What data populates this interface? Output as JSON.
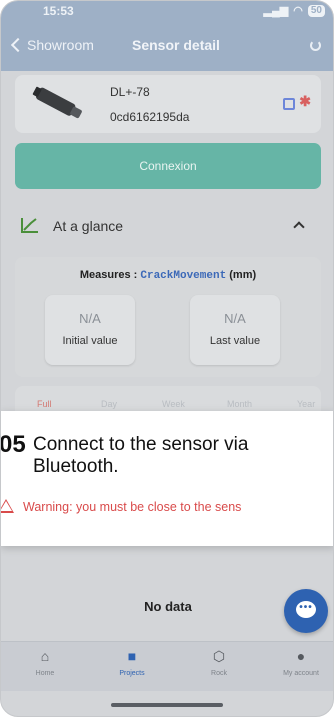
{
  "status": {
    "time": "15:53",
    "battery": "50"
  },
  "nav": {
    "back_label": "Showroom",
    "title": "Sensor detail"
  },
  "sensor": {
    "name": "DL+-78",
    "id": "0cd6162195da"
  },
  "connect_label": "Connexion",
  "glance": {
    "label": "At a glance"
  },
  "measures": {
    "prefix": "Measures : ",
    "metric": "CrackMovement",
    "unit": "(mm)",
    "initial": {
      "value": "N/A",
      "label": "Initial value"
    },
    "last": {
      "value": "N/A",
      "label": "Last value"
    }
  },
  "periods": [
    "Full",
    "Day",
    "Week",
    "Month",
    "Year"
  ],
  "tip": {
    "step": "05",
    "text": "Connect to the sensor via Bluetooth.",
    "warning": "Warning: you must be close to the sens"
  },
  "no_data": "No data",
  "tabs": [
    {
      "label": "Home",
      "icon": "home-icon"
    },
    {
      "label": "Projects",
      "icon": "briefcase-icon"
    },
    {
      "label": "Rock",
      "icon": "rock-icon"
    },
    {
      "label": "My account",
      "icon": "user-icon"
    }
  ],
  "colors": {
    "accent": "#2e62b1",
    "connect": "#66b5a6",
    "warning": "#d94b4b"
  }
}
